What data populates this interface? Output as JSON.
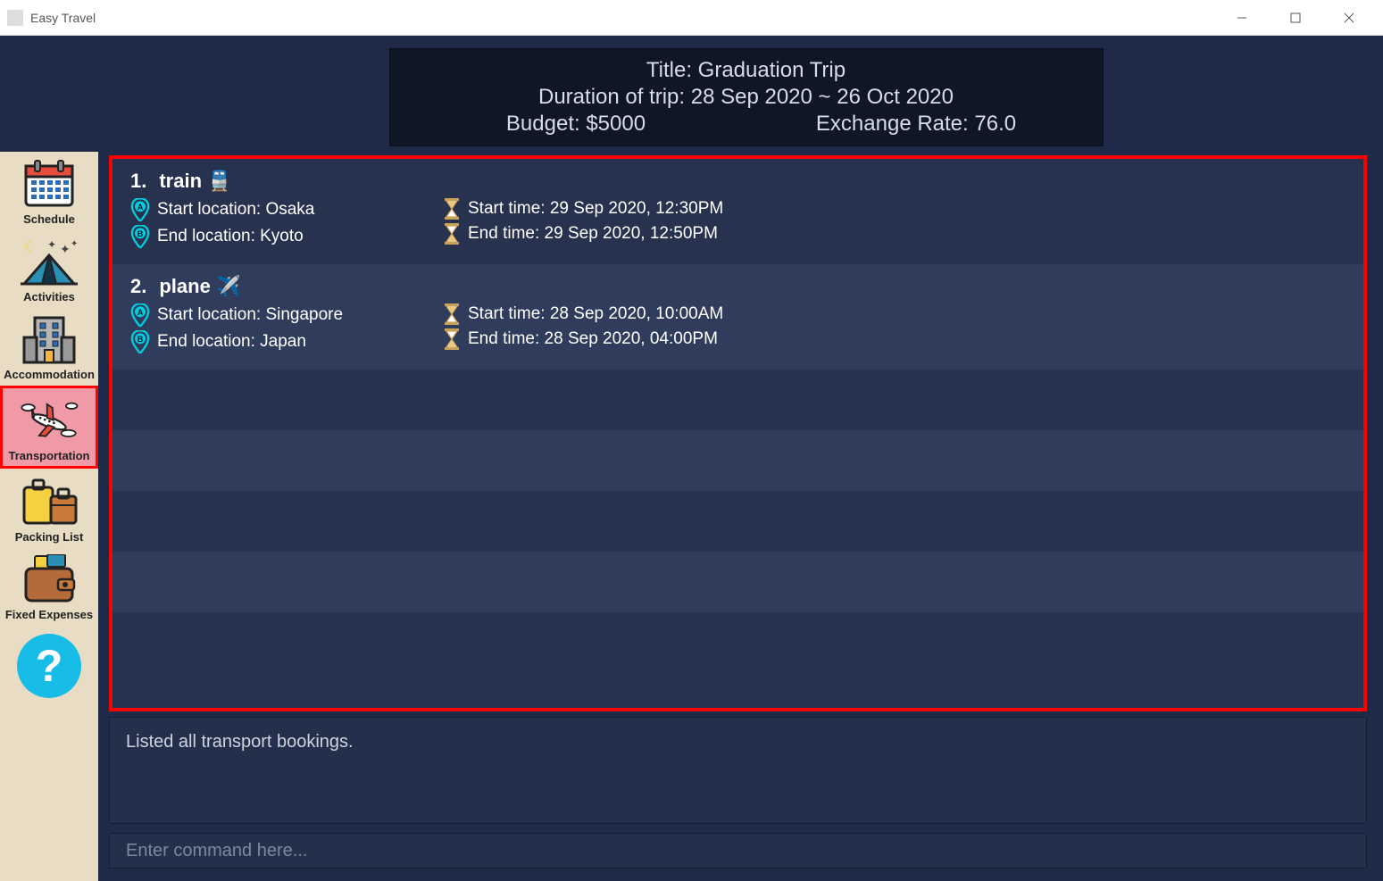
{
  "window": {
    "title": "Easy Travel"
  },
  "sidebar": {
    "items": [
      {
        "label": "Schedule"
      },
      {
        "label": "Activities"
      },
      {
        "label": "Accommodation"
      },
      {
        "label": "Transportation"
      },
      {
        "label": "Packing List"
      },
      {
        "label": "Fixed Expenses"
      }
    ]
  },
  "header": {
    "title": "Title: Graduation Trip",
    "duration": "Duration of trip: 28 Sep 2020 ~ 26 Oct 2020",
    "budget": "Budget: $5000",
    "rate": "Exchange Rate: 76.0"
  },
  "transports": [
    {
      "num": "1.",
      "mode": "train",
      "emoji": "🚆",
      "start_loc": "Start location: Osaka",
      "end_loc": "End location: Kyoto",
      "start_time": "Start time: 29 Sep 2020, 12:30PM",
      "end_time": "End time: 29 Sep 2020, 12:50PM"
    },
    {
      "num": "2.",
      "mode": "plane",
      "emoji": "✈️",
      "start_loc": "Start location: Singapore",
      "end_loc": "End location: Japan",
      "start_time": "Start time: 28 Sep 2020, 10:00AM",
      "end_time": "End time: 28 Sep 2020, 04:00PM"
    }
  ],
  "status": {
    "message": "Listed all transport bookings."
  },
  "command": {
    "placeholder": "Enter command here..."
  }
}
